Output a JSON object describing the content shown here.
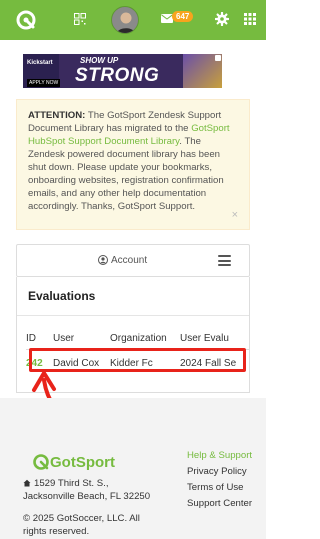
{
  "header": {
    "mail_badge": "647"
  },
  "ad": {
    "brand": "Kickstart",
    "line1": "SHOW UP",
    "line2": "STRONG",
    "cta": "APPLY NOW"
  },
  "notice": {
    "heading": "ATTENTION:",
    "text_before": " The GotSport Zendesk Support Document Library has migrated to the ",
    "link": "GotSport HubSpot Support Document Library",
    "text_after": ". The Zendesk powered document library has been shut down. Please update your bookmarks, onboarding websites, registration confirmation emails, and any other help documentation accordingly. Thanks, GotSport Support.",
    "close": "×"
  },
  "account": {
    "label": "Account"
  },
  "evaluations": {
    "title": "Evaluations",
    "columns": [
      "ID",
      "User",
      "Organization",
      "User Evalu"
    ],
    "rows": [
      {
        "id": "242",
        "user": "David Cox",
        "organization": "Kidder Fc",
        "evaluation": "2024 Fall Se"
      }
    ]
  },
  "footer": {
    "logo": "GotSport",
    "address": "1529 Third St. S., Jacksonville Beach, FL 32250",
    "copyright": "© 2025 GotSoccer, LLC. All rights reserved.",
    "links": [
      "Help & Support",
      "Privacy Policy",
      "Terms of Use",
      "Support Center"
    ]
  },
  "colors": {
    "brand_green": "#76bb3f",
    "badge_orange": "#f7a41d",
    "annotation_red": "#e8231a",
    "notice_bg": "#fcf8e3"
  }
}
